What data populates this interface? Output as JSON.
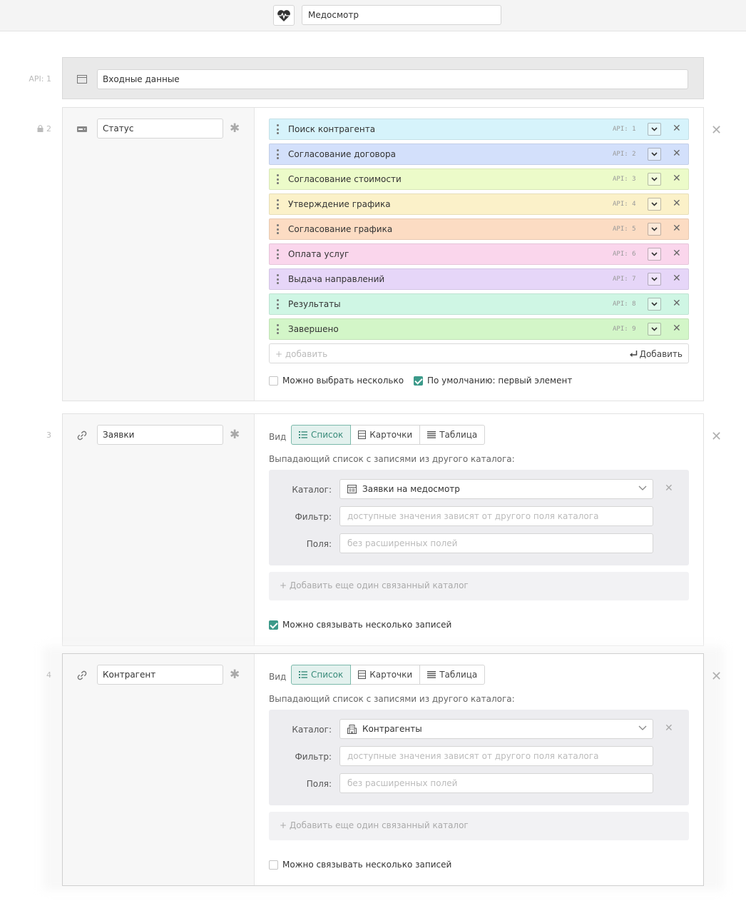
{
  "header": {
    "app_icon": "heart-pulse-icon",
    "title_value": "Медосмотр"
  },
  "sections": {
    "s1": {
      "api": "API: 1",
      "name": "Входные данные"
    },
    "s2": {
      "api": "2",
      "name": "Статус",
      "items": [
        {
          "label": "Поиск контрагента",
          "api": "API: 1",
          "color": "#d6f3fb"
        },
        {
          "label": "Согласование договора",
          "api": "API: 2",
          "color": "#d3e0fb"
        },
        {
          "label": "Согласование стоимости",
          "api": "API: 3",
          "color": "#ecfbc9"
        },
        {
          "label": "Утверждение графика",
          "api": "API: 4",
          "color": "#fbf1c9"
        },
        {
          "label": "Согласование графика",
          "api": "API: 5",
          "color": "#fcdcc3"
        },
        {
          "label": "Оплата услуг",
          "api": "API: 6",
          "color": "#fad6ec"
        },
        {
          "label": "Выдача направлений",
          "api": "API: 7",
          "color": "#e6d6f8"
        },
        {
          "label": "Результаты",
          "api": "API: 8",
          "color": "#cff6e4"
        },
        {
          "label": "Завершено",
          "api": "API: 9",
          "color": "#d3f6c8"
        }
      ],
      "add_placeholder": "+ добавить",
      "add_button": "Добавить",
      "multi_label": "Можно выбрать несколько",
      "default_label": "По умолчанию: первый элемент"
    },
    "s3": {
      "api": "3",
      "name": "Заявки",
      "view_label": "Вид",
      "views": [
        "Список",
        "Карточки",
        "Таблица"
      ],
      "desc": "Выпадающий список с записями из другого каталога:",
      "catalog_label": "Каталог:",
      "catalog_value": "Заявки на медосмотр",
      "filter_label": "Фильтр:",
      "filter_placeholder": "доступные значения зависят от другого поля каталога",
      "fields_label": "Поля:",
      "fields_placeholder": "без расширенных полей",
      "add_catalog": "+ Добавить еще один связанный каталог",
      "multi_label": "Можно связывать несколько записей"
    },
    "s4": {
      "api": "4",
      "name": "Контрагент",
      "view_label": "Вид",
      "views": [
        "Список",
        "Карточки",
        "Таблица"
      ],
      "desc": "Выпадающий список с записями из другого каталога:",
      "catalog_label": "Каталог:",
      "catalog_value": "Контрагенты",
      "filter_label": "Фильтр:",
      "filter_placeholder": "доступные значения зависят от другого поля каталога",
      "fields_label": "Поля:",
      "fields_placeholder": "без расширенных полей",
      "add_catalog": "+ Добавить еще один связанный каталог",
      "multi_label": "Можно связывать несколько записей"
    }
  },
  "colors": {
    "accent": "#3c9a8a"
  },
  "state": {
    "s2_multi": false,
    "s2_default": true,
    "s3_multi": true,
    "s4_multi": false,
    "active_view": "Список"
  }
}
